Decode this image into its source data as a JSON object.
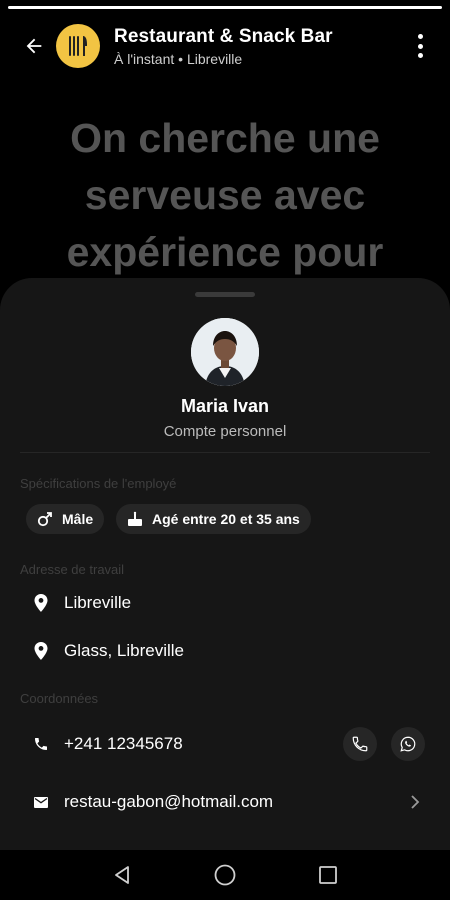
{
  "header": {
    "title": "Restaurant & Snack Bar",
    "subtitle": "À l'instant • Libreville"
  },
  "headline": "On cherche une serveuse avec expérience pour",
  "profile": {
    "name": "Maria Ivan",
    "account_type": "Compte personnel"
  },
  "specs": {
    "label": "Spécifications de l'employé",
    "chips": [
      {
        "label": "Mâle",
        "icon": "gender-icon"
      },
      {
        "label": "Agé entre 20 et 35 ans",
        "icon": "cake-icon"
      }
    ]
  },
  "work_address": {
    "label": "Adresse de travail",
    "items": [
      "Libreville",
      "Glass, Libreville"
    ]
  },
  "contact": {
    "label": "Coordonnées",
    "phone": "+241 12345678",
    "email": "restau-gabon@hotmail.com"
  },
  "colors": {
    "logo_bg": "#f2c443",
    "sheet_bg": "#161616",
    "chip_bg": "#262626"
  }
}
